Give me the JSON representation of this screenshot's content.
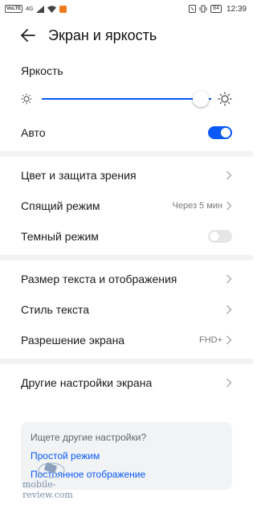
{
  "statusbar": {
    "left_badge": "VoLTE",
    "signal": "4G",
    "time": "12:39",
    "battery": "84"
  },
  "header": {
    "title": "Экран и яркость"
  },
  "brightness": {
    "label": "Яркость",
    "level_percent": 94
  },
  "auto": {
    "label": "Авто",
    "enabled": true
  },
  "group1": [
    {
      "label": "Цвет и защита зрения",
      "value": ""
    },
    {
      "label": "Спящий режим",
      "value": "Через 5 мин"
    },
    {
      "label": "Темный режим",
      "toggle": false
    }
  ],
  "group2": [
    {
      "label": "Размер текста и отображения",
      "value": ""
    },
    {
      "label": "Стиль текста",
      "value": ""
    },
    {
      "label": "Разрешение экрана",
      "value": "FHD+"
    }
  ],
  "group3": [
    {
      "label": "Другие настройки экрана",
      "value": ""
    }
  ],
  "search_card": {
    "question": "Ищете другие настройки?",
    "link1": "Простой режим",
    "link2": "Постоянное отображение"
  },
  "watermark": {
    "text": "mobile-review.com"
  },
  "colors": {
    "accent": "#0a59f7",
    "divider": "#f1f3f5"
  }
}
